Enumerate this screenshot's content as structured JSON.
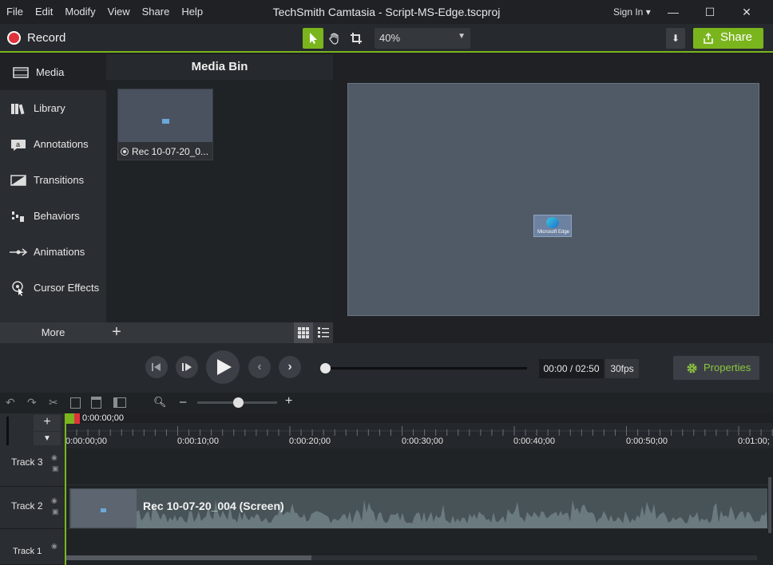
{
  "window": {
    "menu": [
      "File",
      "Edit",
      "Modify",
      "View",
      "Share",
      "Help"
    ],
    "title": "TechSmith Camtasia - Script-MS-Edge.tscproj",
    "sign_in": "Sign In ▾",
    "minimize": "—",
    "maximize": "☐",
    "close": "✕"
  },
  "toolbar": {
    "record_label": "Record",
    "zoom_value": "40%",
    "share_label": "Share"
  },
  "sidebar": {
    "items": [
      {
        "label": "Media",
        "icon": "film-strip-icon",
        "active": true
      },
      {
        "label": "Library",
        "icon": "books-icon"
      },
      {
        "label": "Annotations",
        "icon": "annotation-icon"
      },
      {
        "label": "Transitions",
        "icon": "transition-icon"
      },
      {
        "label": "Behaviors",
        "icon": "behaviors-icon"
      },
      {
        "label": "Animations",
        "icon": "animation-arrow-icon"
      },
      {
        "label": "Cursor Effects",
        "icon": "cursor-effects-icon"
      }
    ],
    "more_label": "More"
  },
  "media_bin": {
    "title": "Media Bin",
    "clip_name": "Rec 10-07-20_0..."
  },
  "canvas": {
    "desktop_icon_label": "Microsoft Edge"
  },
  "transport": {
    "time": "00:00 / 02:50",
    "fps": "30fps",
    "properties_label": "Properties"
  },
  "timeline": {
    "playhead_time": "0:00:00;00",
    "ticks": [
      "0:00:00;00",
      "0:00:10;00",
      "0:00:20;00",
      "0:00:30;00",
      "0:00:40;00",
      "0:00:50;00",
      "0:01:00;"
    ],
    "tracks": [
      {
        "label": "Track 3"
      },
      {
        "label": "Track 2"
      },
      {
        "label": "Track 1"
      }
    ],
    "clip_label": "Rec 10-07-20_004 (Screen)"
  },
  "colors": {
    "accent": "#7ab51d",
    "record": "#e0323c",
    "canvas": "#505a67"
  }
}
